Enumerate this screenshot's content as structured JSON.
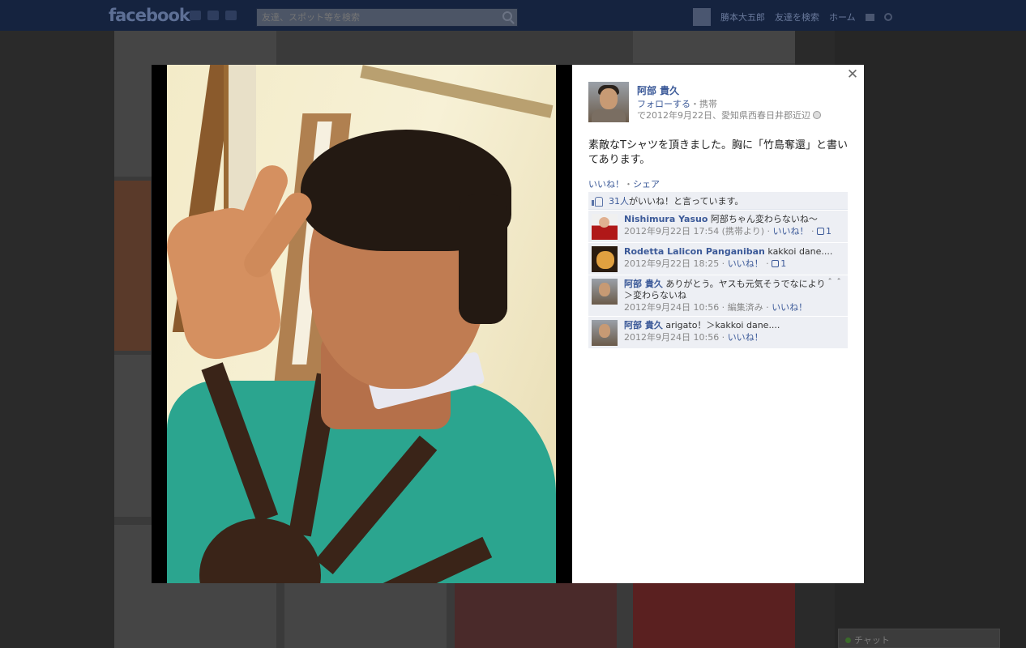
{
  "topbar": {
    "logo": "facebook",
    "search_placeholder": "友達、スポット等を検索",
    "nav_user": "勝本大五郎",
    "nav_find_friends": "友達を検索",
    "nav_home": "ホーム"
  },
  "chat": {
    "label": "チャット"
  },
  "post": {
    "author_name": "阿部 貴久",
    "follow": "フォローする",
    "via": "携帯",
    "date_location": "で2012年9月22日、愛知県西春日井郡近辺",
    "caption": "素敵なTシャツを頂きました。胸に「竹島奪還」と書いてあります。",
    "actions": {
      "like": "いいね！",
      "share": "シェア"
    },
    "likes": {
      "count": "31人",
      "text": "がいいね！と言っています。"
    },
    "comments": [
      {
        "name": "Nishimura Yasuo",
        "text": "阿部ちゃん変わらないね〜",
        "time": "2012年9月22日 17:54 (携帯より)",
        "like": "いいね！",
        "likes": "1"
      },
      {
        "name": "Rodetta Lalicon Panganiban",
        "text": "kakkoi dane....",
        "time": "2012年9月22日 18:25",
        "like": "いいね！",
        "likes": "1"
      },
      {
        "name": "阿部 貴久",
        "text": "ありがとう。ヤスも元気そうでなにより＾＾＞変わらないね",
        "time": "2012年9月24日 10:56",
        "edited": "編集済み",
        "like": "いいね！"
      },
      {
        "name": "阿部 貴久",
        "text": "arigato！＞kakkoi dane....",
        "time": "2012年9月24日 10:56",
        "like": "いいね！"
      }
    ]
  }
}
